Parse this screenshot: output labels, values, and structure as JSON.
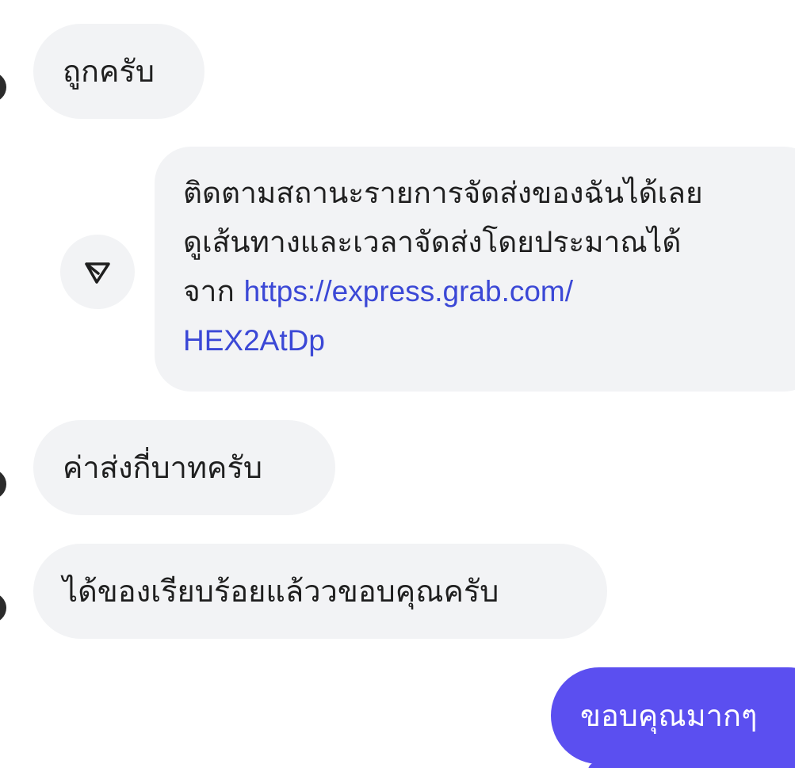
{
  "messages": {
    "m1": {
      "text": "ถูกครับ"
    },
    "m2": {
      "line1": "ติดตามสถานะรายการจัดส่งของฉันได้เลย",
      "line2": "ดูเส้นทางและเวลาจัดส่งโดยประมาณได้",
      "line3_prefix": "จาก",
      "link_part1": "https://express.grab.com/",
      "link_part2": "HEX2AtDp"
    },
    "m3": {
      "text": "ค่าส่งกี่บาทครับ"
    },
    "m4": {
      "text": "ได้ของเรียบร้อยแล้ววขอบคุณครับ"
    },
    "m5": {
      "text": "ขอบคุณมากๆ"
    }
  },
  "icons": {
    "share": "send-arrow-icon"
  },
  "colors": {
    "incoming_bubble": "#f2f3f5",
    "outgoing_bubble": "#5b4ff0",
    "link": "#3b48d6",
    "text": "#1f1f1f"
  }
}
